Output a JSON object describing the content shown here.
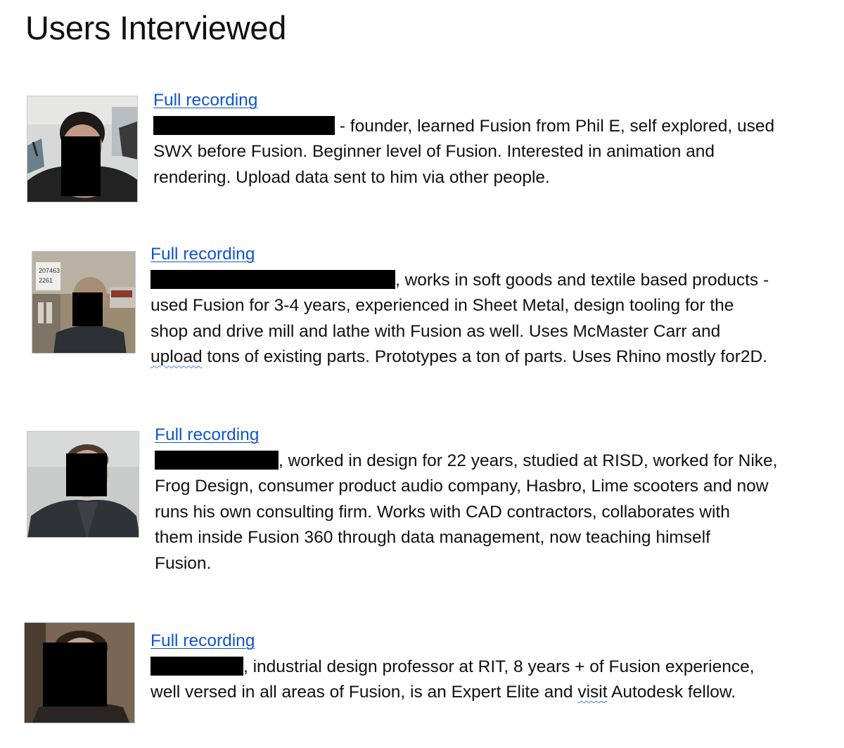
{
  "page": {
    "title": "Users Interviewed"
  },
  "interviewees": [
    {
      "link_label": "Full recording",
      "line1_text": " - founder, learned Fusion from Phil E, self explored, used",
      "line2_text": "SWX before Fusion. Beginner level of Fusion. Interested in animation and",
      "line3_text": "rendering. Upload data sent to him via other people."
    },
    {
      "link_label": "Full recording",
      "photo_sign_text_1": "207463",
      "photo_sign_text_2": "2261",
      "line1_text": ", works in soft goods and textile based products -",
      "line2_text": "used Fusion for 3-4 years, experienced in Sheet Metal, design tooling for the",
      "line3_text": "shop and drive mill and lathe with Fusion as well. Uses McMaster Carr and",
      "line4_flagged_word": "upload",
      "line4_text": " tons of existing parts. Prototypes a ton of parts. Uses Rhino mostly for2D."
    },
    {
      "link_label": "Full recording",
      "line1_text": ", worked in design for 22 years, studied at RISD, worked for Nike,",
      "line2_text": "Frog Design, consumer product audio company, Hasbro, Lime scooters and now",
      "line3_text": "runs his own consulting firm. Works with CAD contractors, collaborates with",
      "line4_text": "them inside Fusion 360 through data management, now teaching himself",
      "line5_text": "Fusion."
    },
    {
      "link_label": "Full recording",
      "line1_text": ", industrial design professor at RIT, 8 years + of Fusion  experience,",
      "line2_before": "well versed in all areas of Fusion, is an Expert Elite and ",
      "line2_flagged_word": "visit",
      "line2_after": " Autodesk fellow."
    }
  ],
  "colors": {
    "link": "#1155cc",
    "redaction": "#000000",
    "spell_flag_red": "#d93025",
    "grammar_flag_blue": "#4a7bd8"
  }
}
